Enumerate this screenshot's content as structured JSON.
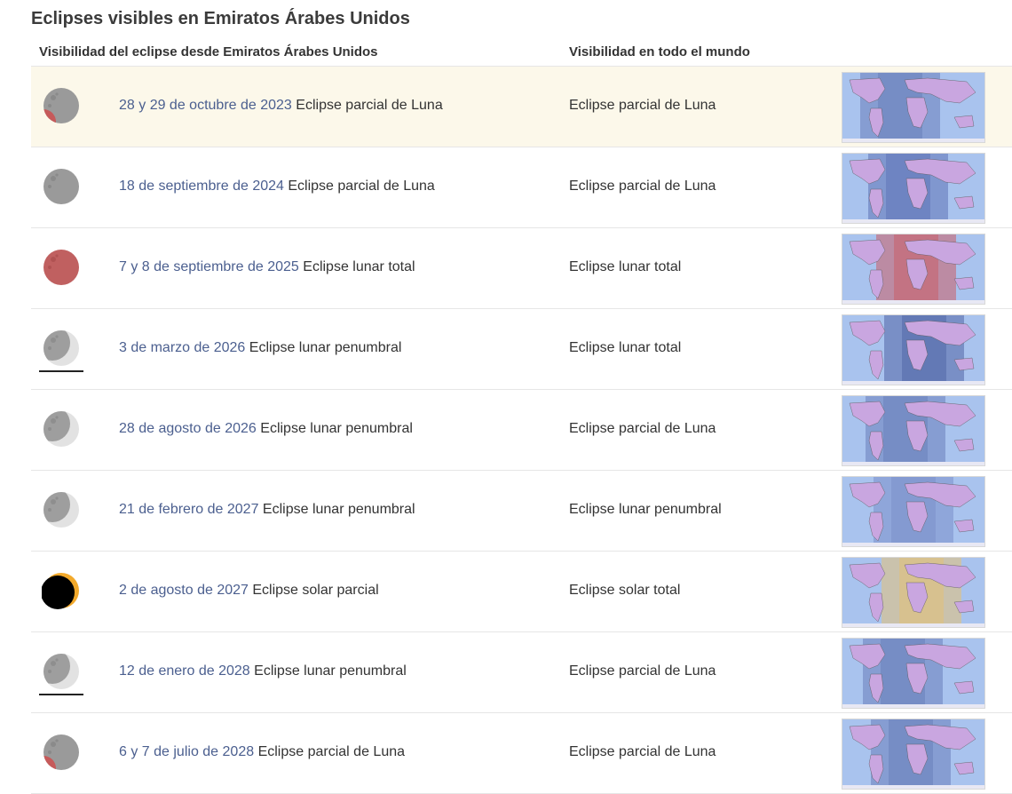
{
  "page": {
    "title": "Eclipses visibles en Emiratos Árabes Unidos",
    "col_local": "Visibilidad del eclipse desde Emiratos Árabes Unidos",
    "col_world": "Visibilidad en todo el mundo"
  },
  "colors": {
    "link": "#4b5f8f",
    "highlight_row": "#fcf8ea",
    "moon_gray": "#9a9a9a",
    "moon_red": "#c06060",
    "sun_gold": "#f2a92b",
    "map_ocean": "#a9c3ee",
    "map_land_visible": "#c9a6e0",
    "map_shadow": "#5a6fb0"
  },
  "eclipses": [
    {
      "date": "28 y 29 de octubre de 2023",
      "type": "Eclipse parcial de Luna",
      "world": "Eclipse parcial de Luna",
      "icon": "partial-lunar-icon",
      "highlighted": true,
      "horizon": false
    },
    {
      "date": "18 de septiembre de 2024",
      "type": "Eclipse parcial de Luna",
      "world": "Eclipse parcial de Luna",
      "icon": "gray-moon-icon",
      "highlighted": false,
      "horizon": false
    },
    {
      "date": "7 y 8 de septiembre de 2025",
      "type": "Eclipse lunar total",
      "world": "Eclipse lunar total",
      "icon": "total-lunar-icon",
      "highlighted": false,
      "horizon": false
    },
    {
      "date": "3 de marzo de 2026",
      "type": " Eclipse lunar penumbral",
      "world": "Eclipse lunar total",
      "icon": "penumbral-lunar-icon",
      "highlighted": false,
      "horizon": true
    },
    {
      "date": "28 de agosto de 2026",
      "type": "Eclipse lunar penumbral",
      "world": "Eclipse parcial de Luna",
      "icon": "penumbral-lunar-icon",
      "highlighted": false,
      "horizon": false
    },
    {
      "date": "21 de febrero de 2027",
      "type": "Eclipse lunar penumbral",
      "world": "Eclipse lunar penumbral",
      "icon": "penumbral-lunar-icon",
      "highlighted": false,
      "horizon": false
    },
    {
      "date": "2 de agosto de 2027",
      "type": "Eclipse solar parcial",
      "world": "Eclipse solar total",
      "icon": "partial-solar-icon",
      "highlighted": false,
      "horizon": false
    },
    {
      "date": "12 de enero de 2028",
      "type": "Eclipse lunar penumbral",
      "world": "Eclipse parcial de Luna",
      "icon": "penumbral-lunar-icon",
      "highlighted": false,
      "horizon": true
    },
    {
      "date": "6 y 7 de julio de 2028",
      "type": "Eclipse parcial de Luna",
      "world": "Eclipse parcial de Luna",
      "icon": "partial-lunar-icon",
      "highlighted": false,
      "horizon": false
    }
  ]
}
